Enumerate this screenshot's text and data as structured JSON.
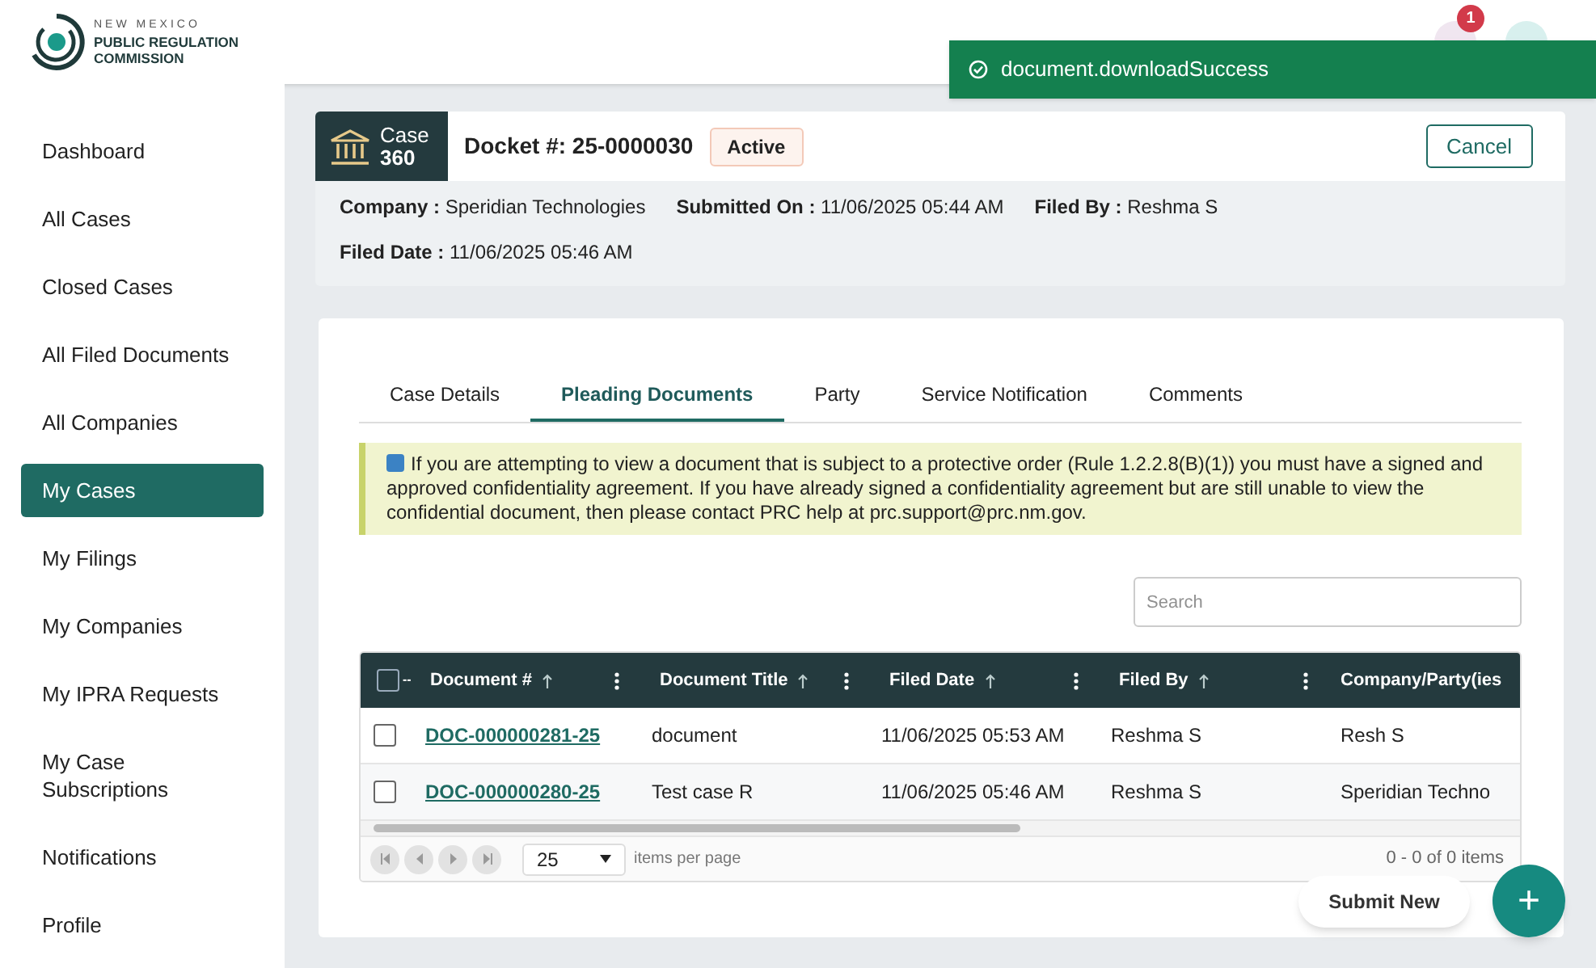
{
  "header": {
    "logo": {
      "line1": "NEW MEXICO",
      "line2": "PUBLIC REGULATION",
      "line3": "COMMISSION"
    },
    "notification_count": "1"
  },
  "toast": {
    "message": "document.downloadSuccess"
  },
  "sidebar": {
    "items": [
      {
        "label": "Dashboard",
        "selected": false
      },
      {
        "label": "All Cases",
        "selected": false
      },
      {
        "label": "Closed Cases",
        "selected": false
      },
      {
        "label": "All Filed Documents",
        "selected": false
      },
      {
        "label": "All Companies",
        "selected": false
      },
      {
        "label": "My Cases",
        "selected": true
      },
      {
        "label": "My Filings",
        "selected": false
      },
      {
        "label": "My Companies",
        "selected": false
      },
      {
        "label": "My IPRA Requests",
        "selected": false
      },
      {
        "label": "My Case Subscriptions",
        "selected": false
      },
      {
        "label": "Notifications",
        "selected": false
      },
      {
        "label": "Profile",
        "selected": false
      }
    ]
  },
  "case": {
    "badge_line1": "Case",
    "badge_line2": "360",
    "docket": "Docket #: 25-0000030",
    "status": "Active",
    "cancel": "Cancel",
    "fields": [
      {
        "label": "Company :",
        "value": "Speridian Technologies"
      },
      {
        "label": "Submitted On :",
        "value": "11/06/2025 05:44 AM"
      },
      {
        "label": "Filed By :",
        "value": "Reshma S"
      },
      {
        "label": "Filed Date :",
        "value": "11/06/2025 05:46 AM"
      }
    ]
  },
  "tabs": [
    {
      "label": "Case Details",
      "selected": false
    },
    {
      "label": "Pleading Documents",
      "selected": true
    },
    {
      "label": "Party",
      "selected": false
    },
    {
      "label": "Service Notification",
      "selected": false
    },
    {
      "label": "Comments",
      "selected": false
    }
  ],
  "notice": "If you are attempting to view a document that is subject to a protective order (Rule 1.2.2.8(B)(1)) you must have a signed and approved confidentiality agreement. If you have already signed a confidentiality agreement but are still unable to view the confidential document, then please contact PRC help at prc.support@prc.nm.gov.",
  "search": {
    "placeholder": "Search"
  },
  "table": {
    "select_all_checked": false,
    "select_menu": "--",
    "columns": [
      {
        "label": "Document #",
        "sortable": true
      },
      {
        "label": "Document Title",
        "sortable": true
      },
      {
        "label": "Filed Date",
        "sortable": true
      },
      {
        "label": "Filed By",
        "sortable": true
      },
      {
        "label": "Company/Party(ies",
        "sortable": false
      }
    ],
    "rows": [
      {
        "checked": false,
        "cells": [
          "DOC-000000281-25",
          "document",
          "11/06/2025 05:53 AM",
          "Reshma S",
          "Resh S"
        ]
      },
      {
        "checked": false,
        "cells": [
          "DOC-000000280-25",
          "Test case R",
          "11/06/2025 05:46 AM",
          "Reshma S",
          "Speridian Techno"
        ]
      }
    ]
  },
  "pager": {
    "page_size": "25",
    "page_size_label": "items per page",
    "summary": "0 - 0 of 0 items"
  },
  "submit_new": "Submit New",
  "fab": "+"
}
